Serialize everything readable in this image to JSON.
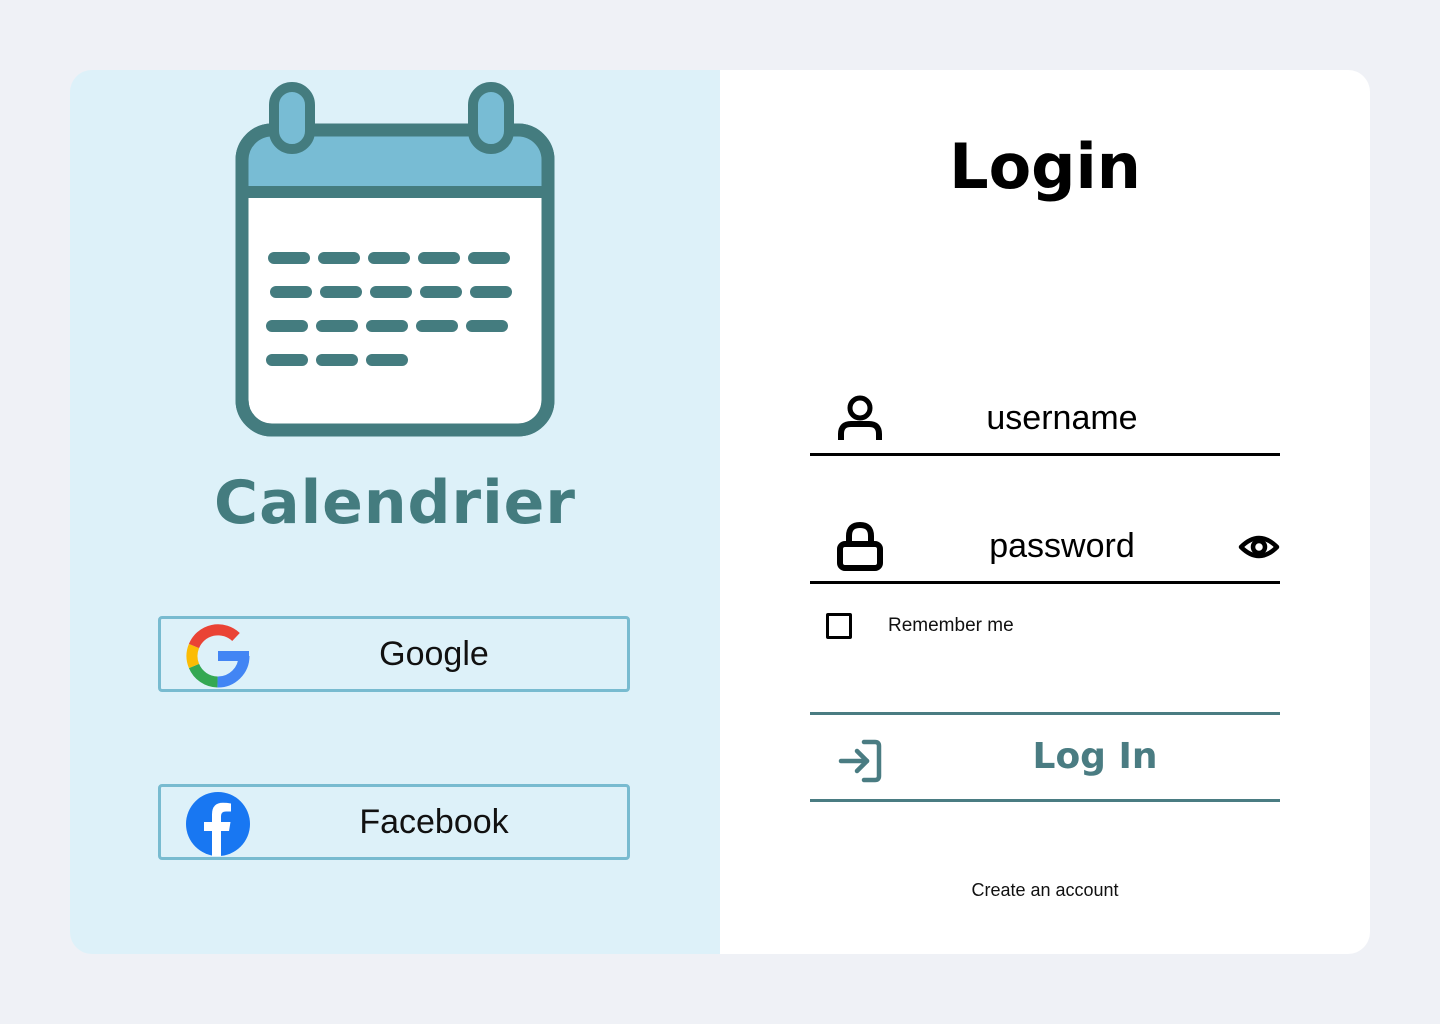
{
  "brand": {
    "name": "Calendrier",
    "icon": "calendar-icon",
    "color": "#447c7f"
  },
  "social": {
    "google_label": "Google",
    "google_icon": "google-logo-icon",
    "facebook_label": "Facebook",
    "facebook_icon": "facebook-logo-icon"
  },
  "login": {
    "title": "Login",
    "username_placeholder": "username",
    "username_value": "",
    "username_icon": "user-icon",
    "password_placeholder": "password",
    "password_value": "",
    "password_icon": "lock-icon",
    "show_password_icon": "eye-icon",
    "remember_label": "Remember me",
    "remember_checked": false,
    "submit_label": "Log In",
    "submit_icon": "sign-in-icon",
    "create_account_label": "Create an account"
  },
  "colors": {
    "left_panel_bg": "#ddf1f9",
    "accent": "#4a7c82",
    "social_border": "#78bbd0",
    "page_bg": "#eff1f6"
  }
}
